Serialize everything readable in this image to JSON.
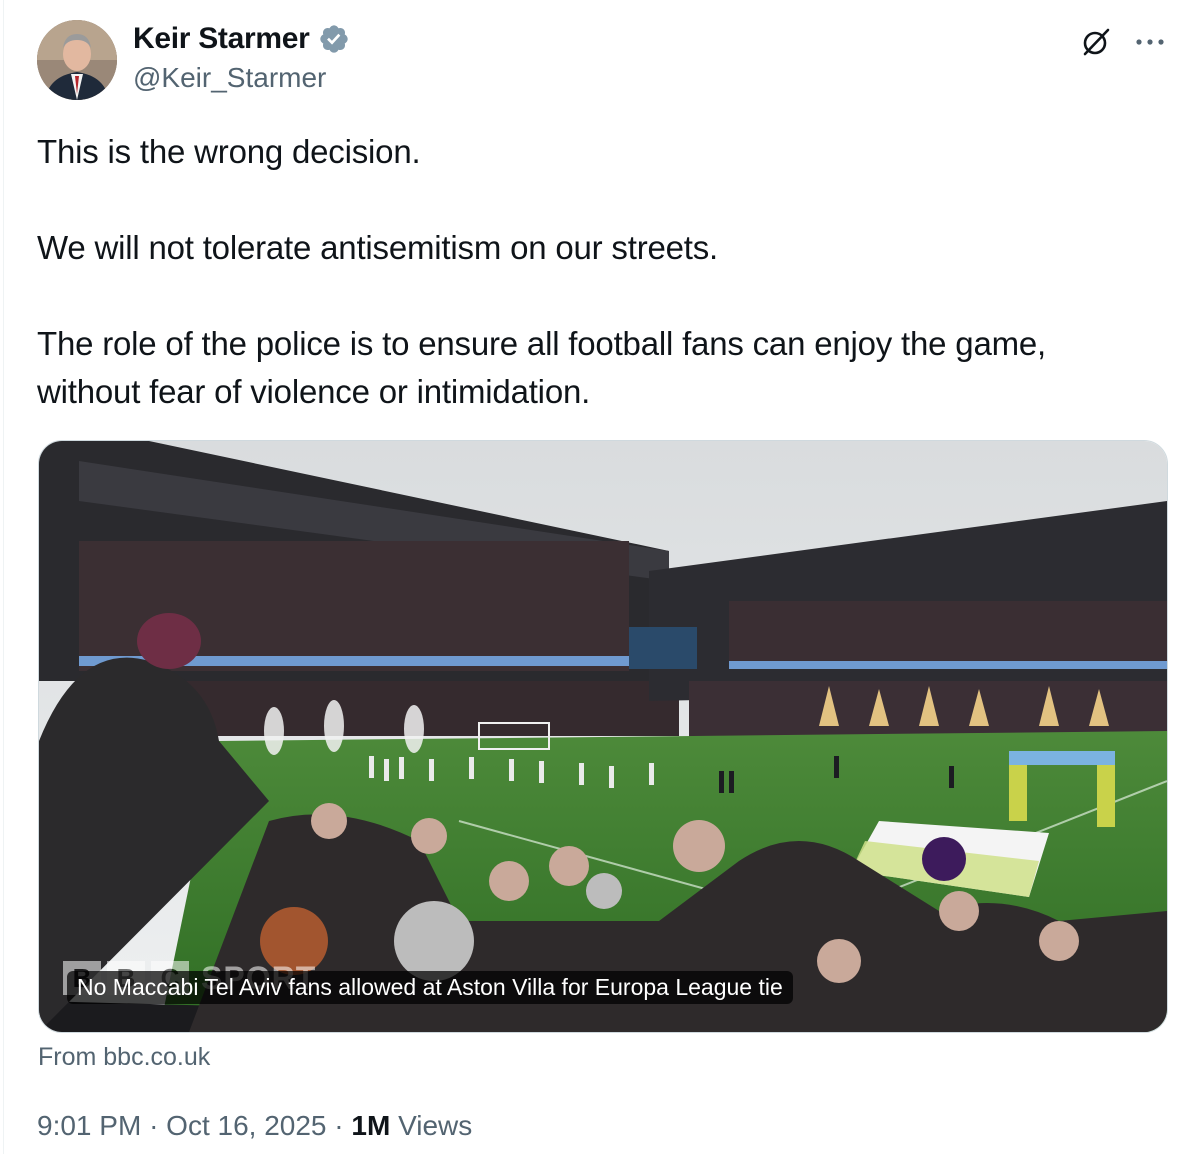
{
  "author": {
    "name": "Keir Starmer",
    "handle": "@Keir_Starmer",
    "verified_color": "#829aab"
  },
  "tweet": {
    "paragraphs": [
      "This is the wrong decision.",
      "We will not tolerate antisemitism on our streets.",
      "The role of the police is to ensure all football fans can enjoy the game, without fear of violence or intimidation."
    ]
  },
  "card": {
    "caption": "No Maccabi Tel Aviv fans allowed at Aston Villa for Europa League tie",
    "watermark": [
      "B",
      "B",
      "C",
      "SPORT"
    ],
    "source": "From bbc.co.uk"
  },
  "meta": {
    "time": "9:01 PM",
    "separator": "·",
    "date": "Oct 16, 2025",
    "views_count": "1M",
    "views_label": "Views"
  },
  "icons": [
    "verified-badge-icon",
    "grok-icon",
    "more-icon"
  ]
}
